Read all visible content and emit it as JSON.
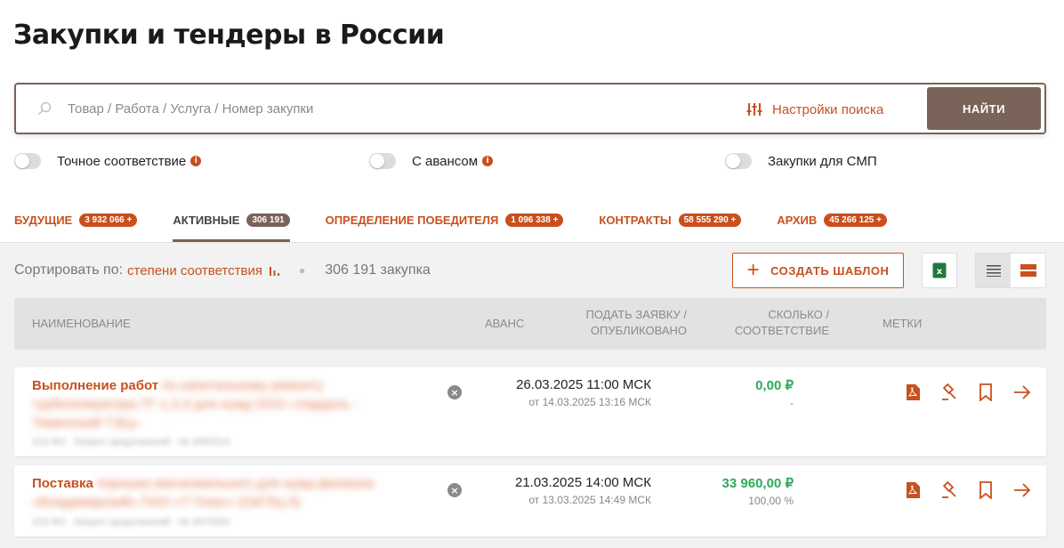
{
  "page": {
    "title": "Закупки и тендеры в России"
  },
  "search": {
    "placeholder": "Товар / Работа / Услуга / Номер закупки",
    "settings_label": "Настройки поиска",
    "find_label": "НАЙТИ"
  },
  "toggles": [
    {
      "label": "Точное соответствие",
      "info": true,
      "on": false
    },
    {
      "label": "С авансом",
      "info": true,
      "on": false
    },
    {
      "label": "Закупки для СМП",
      "info": false,
      "on": false
    }
  ],
  "tabs": [
    {
      "label": "БУДУЩИЕ",
      "badge": "3 932 066 +",
      "active": false
    },
    {
      "label": "АКТИВНЫЕ",
      "badge": "306 191",
      "active": true
    },
    {
      "label": "ОПРЕДЕЛЕНИЕ ПОБЕДИТЕЛЯ",
      "badge": "1 096 338 +",
      "active": false
    },
    {
      "label": "КОНТРАКТЫ",
      "badge": "58 555 290 +",
      "active": false
    },
    {
      "label": "АРХИВ",
      "badge": "45 266 125 +",
      "active": false
    }
  ],
  "sort": {
    "label": "Сортировать по:",
    "value": "степени соответствия",
    "count": "306 191 закупка"
  },
  "toolbar": {
    "create_template": "СОЗДАТЬ ШАБЛОН"
  },
  "table": {
    "headers": {
      "name": "НАИМЕНОВАНИЕ",
      "advance": "АВАНС",
      "submit_1": "ПОДАТЬ ЗАЯВКУ /",
      "submit_2": "ОПУБЛИКОВАНО",
      "amount_1": "СКОЛЬКО /",
      "amount_2": "СООТВЕТСТВИЕ",
      "tags": "МЕТКИ"
    },
    "rows": [
      {
        "title_visible": "Выполнение работ",
        "title_hidden": "по капитальному ремонту турбогенератора ТГ-1,2,3 для нужд ООО «Хардоль - Тюменский ТЭЦ»",
        "meta": "223-ФЗ   ·   Запрос предложений   ·   № 3082514",
        "deadline": "26.03.2025 11:00 МСК",
        "published": "от 14.03.2025 13:16 МСК",
        "amount": "0,00 ₽",
        "match": "-"
      },
      {
        "title_visible": "Поставка",
        "title_hidden": "порошка магнезиального для нужд филиала «Владимирский» ПАО «Т Плюс» (ОкГЛЦ-3)",
        "meta": "223-ФЗ   ·   Запрос предложений   ·   № 3075932",
        "deadline": "21.03.2025 14:00 МСК",
        "published": "от 13.03.2025 14:49 МСК",
        "amount": "33 960,00 ₽",
        "match": "100,00 %"
      }
    ]
  },
  "colors": {
    "accent": "#c8501e",
    "brown": "#7a6358",
    "green": "#2eaa5a"
  }
}
